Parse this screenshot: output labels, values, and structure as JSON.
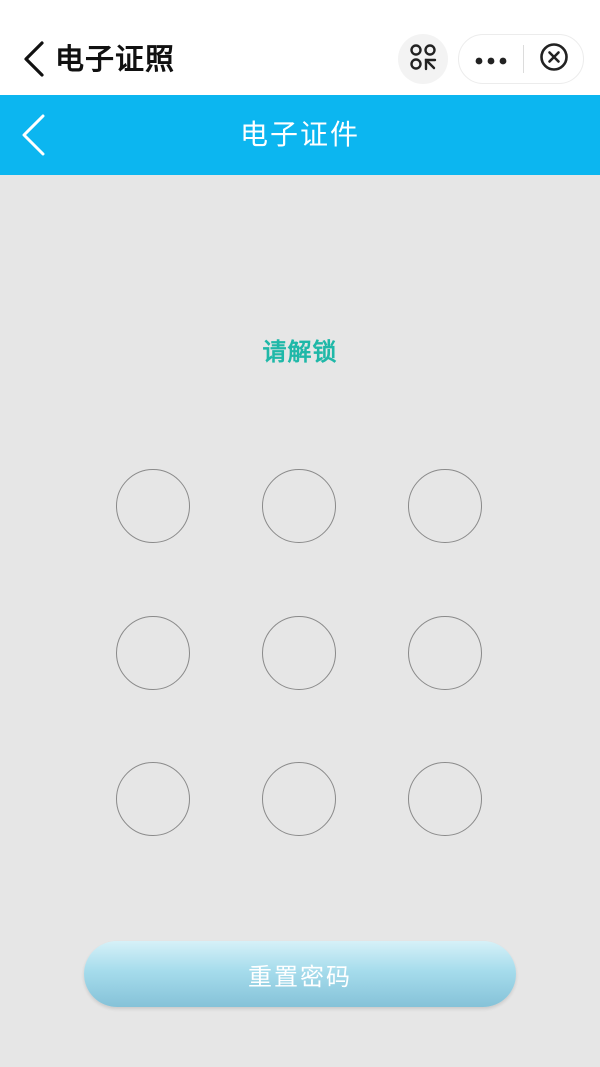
{
  "mini_program_bar": {
    "title": "电子证照",
    "icons": [
      "back-chevron-icon",
      "scan-icon",
      "more-icon",
      "close-circle-icon"
    ]
  },
  "header": {
    "title": "电子证件",
    "back_icon": "back-chevron-icon",
    "background_color": "#0cb6f0"
  },
  "unlock": {
    "prompt": "请解锁",
    "prompt_color": "#1fb8a8",
    "grid": {
      "rows": 3,
      "cols": 3
    }
  },
  "reset_button": {
    "label": "重置密码"
  }
}
